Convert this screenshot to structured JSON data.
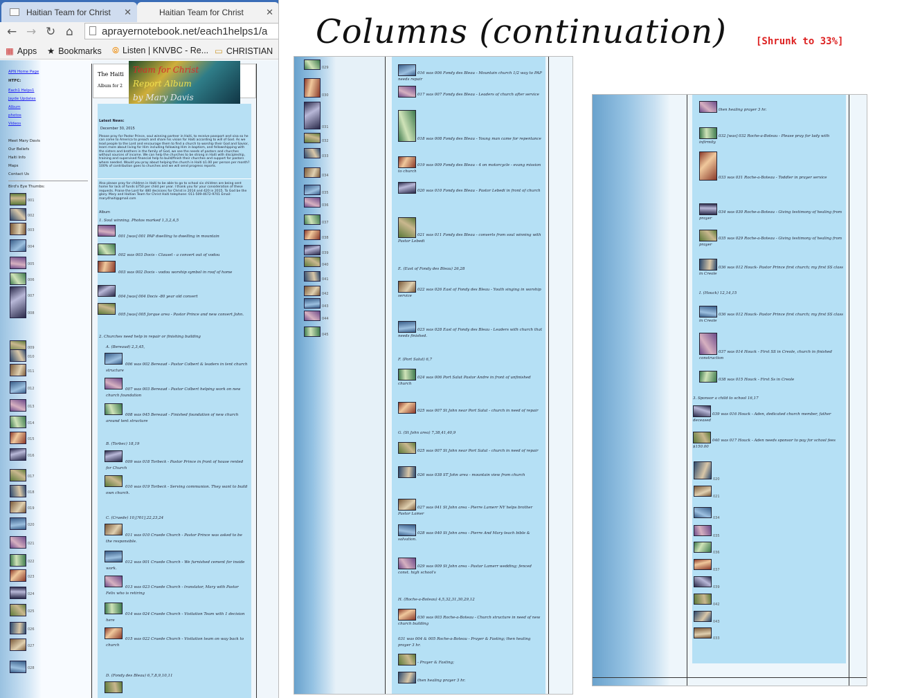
{
  "browser": {
    "tabs": [
      {
        "label": "Haitian Team for Christ",
        "active": false
      },
      {
        "label": "Haitian Team for Christ",
        "active": true
      }
    ],
    "close_glyph": "✕",
    "url": "aprayernotebook.net/each1helps1/a",
    "bookmarks": {
      "apps": "Apps",
      "bookmarks": "Bookmarks",
      "listen": "Listen | KNVBC - Re...",
      "christian": "CHRISTIAN"
    }
  },
  "title": "Columns (continuation)",
  "shrunk_note": "[Shrunk to 33%]",
  "left_nav": {
    "links": [
      "APN Home Page",
      "Each1 Helps1",
      "Jayde Updates",
      "Album",
      "photos",
      "Videos"
    ],
    "heading": "HTFC:",
    "labels": [
      "Meet Mary Davis",
      "Our Beliefs",
      "Haiti Info",
      "Maps",
      "Contact Us"
    ],
    "thumbs_heading": "Bird's Eye Thumbs:",
    "thumb_numbers": [
      "001",
      "002",
      "003",
      "004",
      "005",
      "006",
      "007",
      "008",
      "009",
      "010",
      "011",
      "012",
      "013",
      "014",
      "015",
      "016",
      "017",
      "018",
      "019",
      "020",
      "021",
      "022",
      "023",
      "024",
      "025",
      "026",
      "027",
      "028"
    ]
  },
  "header": {
    "line1": "The Haiti",
    "line2": "Album  for 2",
    "banner_lines": [
      "Team for Christ",
      "Report Album",
      "by Mary Davis"
    ]
  },
  "news": {
    "heading": "Latest News:",
    "date": "December 30, 2015",
    "para1": "Please pray for Pastor Prince, soul winning partner in Haiti, to receive passport and visa so he can come to America to preach and share his vision for Haiti according to will of God. As we lead people to the Lord and encourage them to find a church to worship their God and Savior, learn more about living for Him including following Him in baptism, and fellowshipping with the sisters and brothers in the family of God, we see the needs of pastors and churches without sources of income. We can help the churches to be strong in Haiti with discipleship, training and supervised financial help to build/finish their churches and support for pastors where needed. Would you pray about helping the church in Haiti $1.00 per person per month? 100% of contribution goes to churches and we will send progress reports.",
    "para2": "Also please pray for children in Haiti to be able to go to school six children are being sent home for lack of funds $750 per child per year. I thank you for your consideration of these requests. Praise the Lord for 480 decisions for Christ in 2014 and 420 in 2015. To God be the glory.  Mary and Haitian Team for Christ Haiti telephone: 011-509-4672-9701  Email: mary4haiti@gmail.com",
    "album_label": "Album"
  },
  "panel1_captions": [
    "1. Soul winning. Photos marked 1,3,2,4,5",
    "001 [was] 001 PAP dwelling to dwelling in mountain",
    "002 was 003 Docis - Clausel - a convert out of vodou",
    "003 was 002 Docis - vodou worship symbol in roof of home",
    "004 [was] 004 Docis -80 year old convert",
    "005 [was] 005 Jorque area - Pastor Prince and new convert John.",
    "2. Churches need help in repair or finishing building",
    "A. (Bereaud) 2,3,45,",
    "006 was 002 Bereaud - Pastor Colbert & leaders in tent church structure",
    "007 was 003 Bereaud - Pastor Colbert helping work on new church foundation",
    "008 was 045 Bereaud - Finished foundation of new church around tent structure",
    "B. (Torbec) 18,19",
    "009 was 018 Torbeck - Pastor Prince in front of house rented for Church",
    "010 was 019 Torbeck - Serving communion. They want to build own church.",
    "C. (Cruede) 10,[?01],22,23,24",
    "011 was 010 Cruede Church - Pastor Prince was asked to be the responsible.",
    "012 was 001 Cruede Church - We furnished cement for inside work.",
    "013 was 023 Cruede Church - translator, Mary with Pastor Felix who is retiring",
    "014 was 024 Cruede Church - Visitation Team with 1 decision here",
    "015 was 022 Cruede Church - Visitation team on way back to church",
    "D. (Fondy des Bleau) 6,7,8,9,10,11"
  ],
  "panel2_thumb_numbers": [
    "029",
    "030",
    "031",
    "032",
    "033",
    "034",
    "035",
    "036",
    "037",
    "038",
    "039",
    "040",
    "041",
    "042",
    "043",
    "044",
    "045"
  ],
  "panel2_captions": [
    "016 was 006 Fondy des Bleau - Mountain church 1/2 way to PAP needs repair",
    "017 was 007 Fondy des Bleau - Leaders of church after service",
    "018 was 008 Fondy des Bleau - Young man came for repentance",
    "019 was 009 Fondy des Bleau - 4 on motorcycle - evang mission to church",
    "020 was 010 Fondy des Bleau - Pastor Lebedi in front of church",
    "021 was 011 Fondy des Bleau - converts from soul winning with Pastor Lebedi",
    "E. (East of Fondy des Bleau) 26,28",
    "022 was 026 East of Fondy des Bleau - Youth singing in worship service",
    "023 was 028 East of Fondy des Bleau - Leaders with church that needs finished.",
    "F. (Port Salut) 6,7",
    "024 was 006 Port Salut Pastor Andre in front of unfinished church",
    "025 was 007 St John near Port Salut - church in need of repair",
    "G. (St John area) 7,38,41,40,9",
    "025 was 007 St John near Port Salut - church in need of repair",
    "026 was 038 ST John area - mountain view from church",
    "027 was 041 St John area - Pierre Lamerr NY helps brother Pastor Lamer",
    "028 was 040 St John area - Pierre And Mary teach bible & salvation.",
    "029 was 009 St John area - Pastor Lamerr wedding; fenced const. high school's",
    "H. (Roche-a-Boteau) 4,5,32,31,30,29,12",
    "030 was 003 Roche-a-Boteau - Church structure in need of new church building",
    "031 was 004 & 005 Roche-a-Boteau - Prayer & Fasting; then healing prayer 3 hr.",
    "- Prayer & Fasting;",
    "then healing prayer 3 hr."
  ],
  "panel3_captions": [
    "then healing prayer 3 hr.",
    "032 [was] 032 Roche-a-Boteau - Please pray for lady with infirmity",
    "033 was 031 Roche-a-Boteau - Toddler in prayer service",
    "034 was 030 Roche-a-Boteau - Giving testimony of healing from prayer",
    "035 was 029 Roche-a-Boteau - Giving testimony of healing from prayer",
    "036 was 012 Houck- Pastor Prince first church; my first SS class in Creole",
    "I. (Houck) 12,14,15",
    "036 was 012 Houck- Pastor Prince first church; my first SS class in Creole",
    "037 was 014 Houck - First SS in Creole, church in finished construction",
    "038 was 015 Houck - First Ss in Creole",
    "3. Sponsor a child to school 16,17",
    "039 was 016 Houck - Aden, dedicated church member, father deceased",
    "040 was 017 Houck - Aden needs sponsor to pay for school fees $150.00"
  ],
  "panel3_thumb_numbers": [
    "020",
    "021",
    "034",
    "035",
    "036",
    "037",
    "039",
    "042",
    "043",
    "033"
  ]
}
